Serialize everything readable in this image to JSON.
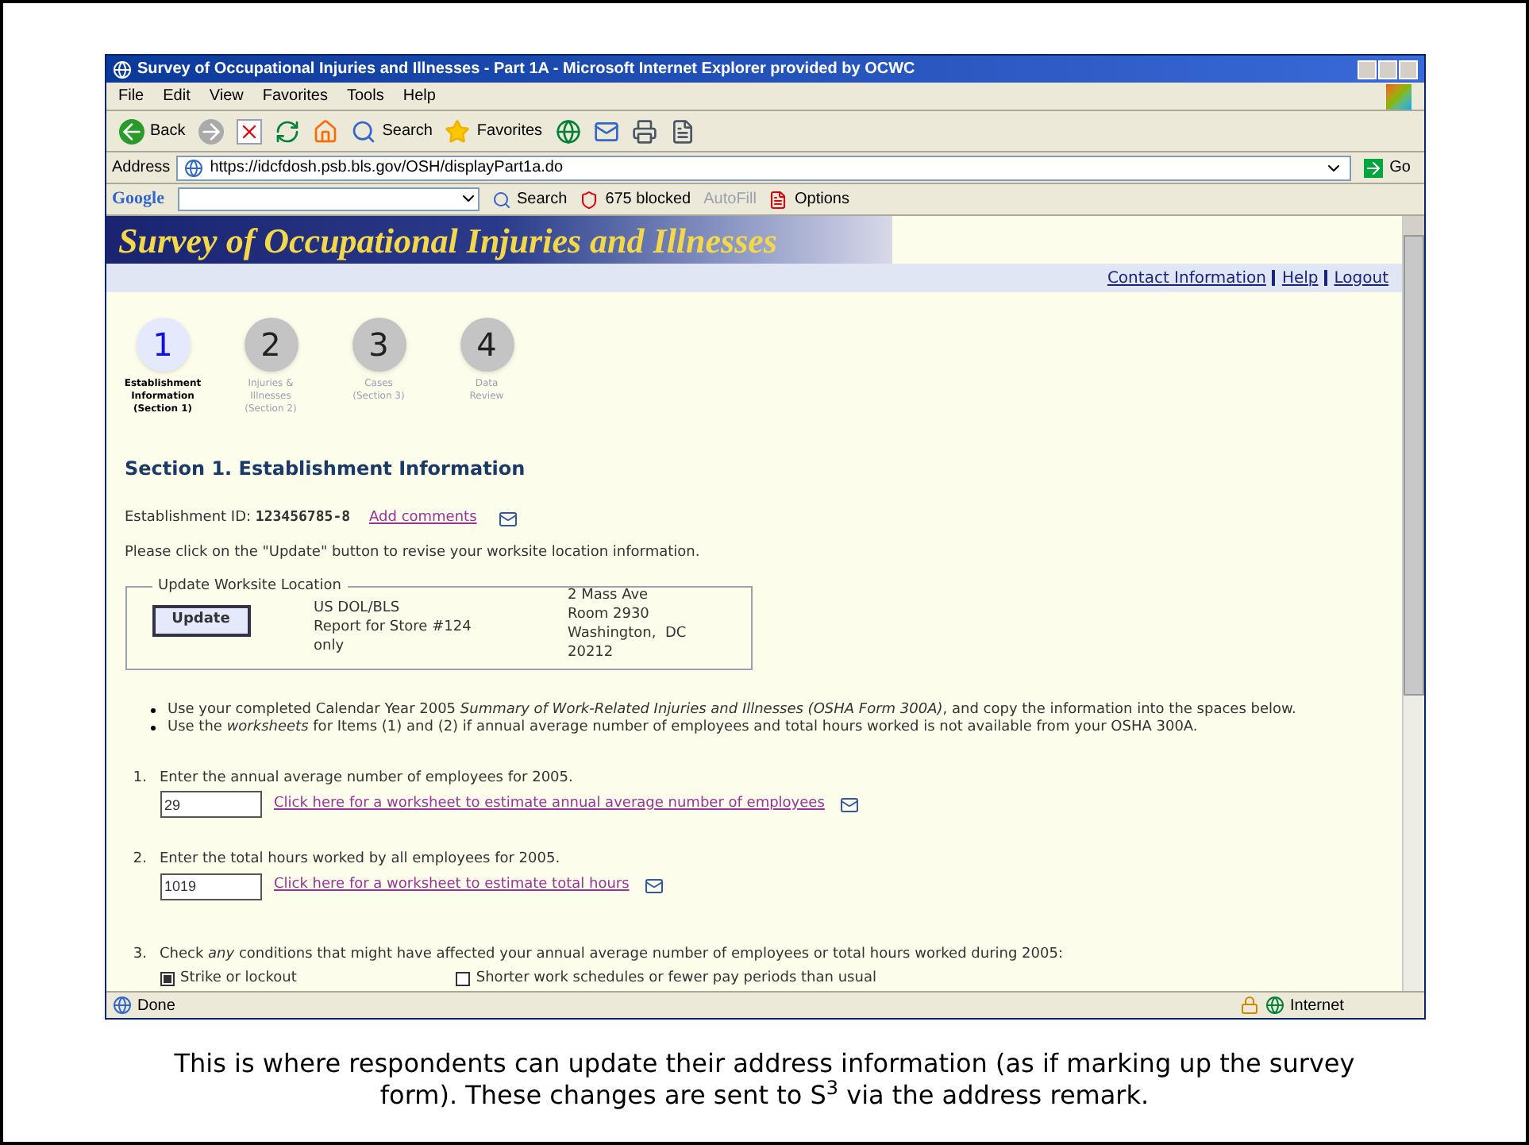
{
  "window": {
    "title": "Survey of Occupational Injuries and Illnesses - Part 1A - Microsoft Internet Explorer provided by OCWC"
  },
  "menu": [
    "File",
    "Edit",
    "View",
    "Favorites",
    "Tools",
    "Help"
  ],
  "toolbar": {
    "back": "Back",
    "search": "Search",
    "favorites": "Favorites"
  },
  "address": {
    "label": "Address",
    "value": "https://idcfdosh.psb.bls.gov/OSH/displayPart1a.do",
    "go": "Go"
  },
  "google_bar": {
    "logo": "Google",
    "search": "Search",
    "blocked": "675 blocked",
    "autofill": "AutoFill",
    "options": "Options"
  },
  "banner": {
    "title": "Survey of Occupational Injuries and Illnesses"
  },
  "top_links": [
    "Contact Information",
    "Help",
    "Logout"
  ],
  "steps": [
    {
      "number": "1",
      "label": [
        "Establishment",
        "Information",
        "(Section 1)"
      ],
      "selected": true
    },
    {
      "number": "2",
      "label": [
        "Injuries &",
        "Illnesses",
        "(Section 2)"
      ],
      "selected": false
    },
    {
      "number": "3",
      "label": [
        "Cases",
        "(Section 3)"
      ],
      "selected": false
    },
    {
      "number": "4",
      "label": [
        "Data",
        "Review"
      ],
      "selected": false
    }
  ],
  "section_title": "Section 1. Establishment Information",
  "establishment": {
    "label": "Establishment ID:",
    "value": "123456785-8",
    "comments_link": "Add comments"
  },
  "instruction": "Please click on the \"Update\" button to revise your worksite location information.",
  "worksite": {
    "legend": "Update Worksite Location",
    "button": "Update",
    "name": [
      "US DOL/BLS",
      "Report for Store #124",
      "only"
    ],
    "address": [
      "2 Mass Ave",
      "Room 2930",
      "Washington,  DC",
      "20212"
    ]
  },
  "bullets": [
    "Use your completed Calendar Year 2005 *Summary of Work-Related Injuries and Illnesses (OSHA Form 300A)*, and copy the information into the spaces below.",
    "Use the *worksheets* for Items (1) and (2) if annual average number of employees and total hours worked is not available from your OSHA 300A."
  ],
  "questions": [
    {
      "number": "1.",
      "text": "Enter the annual average number of employees for 2005.",
      "value": "29",
      "link": "Click here for a worksheet to estimate annual average number of employees"
    },
    {
      "number": "2.",
      "text": "Enter the total hours worked by all employees for 2005.",
      "value": "1019",
      "link": "Click here for a worksheet to estimate total hours"
    }
  ],
  "question_3": {
    "number": "3.",
    "text": "Check *any* conditions that might have affected your annual average number of employees or total hours worked during 2005:",
    "options": [
      {
        "label": "Strike or lockout",
        "checked": true
      },
      {
        "label": "Shorter work schedules or fewer pay periods than usual",
        "checked": false
      }
    ]
  },
  "status_bar": {
    "text": "Done",
    "zone": "Internet"
  },
  "caption": "This is where respondents can update their address information (as if marking up the survey form).  These changes are sent to S$^{3}$ via the address remark."
}
